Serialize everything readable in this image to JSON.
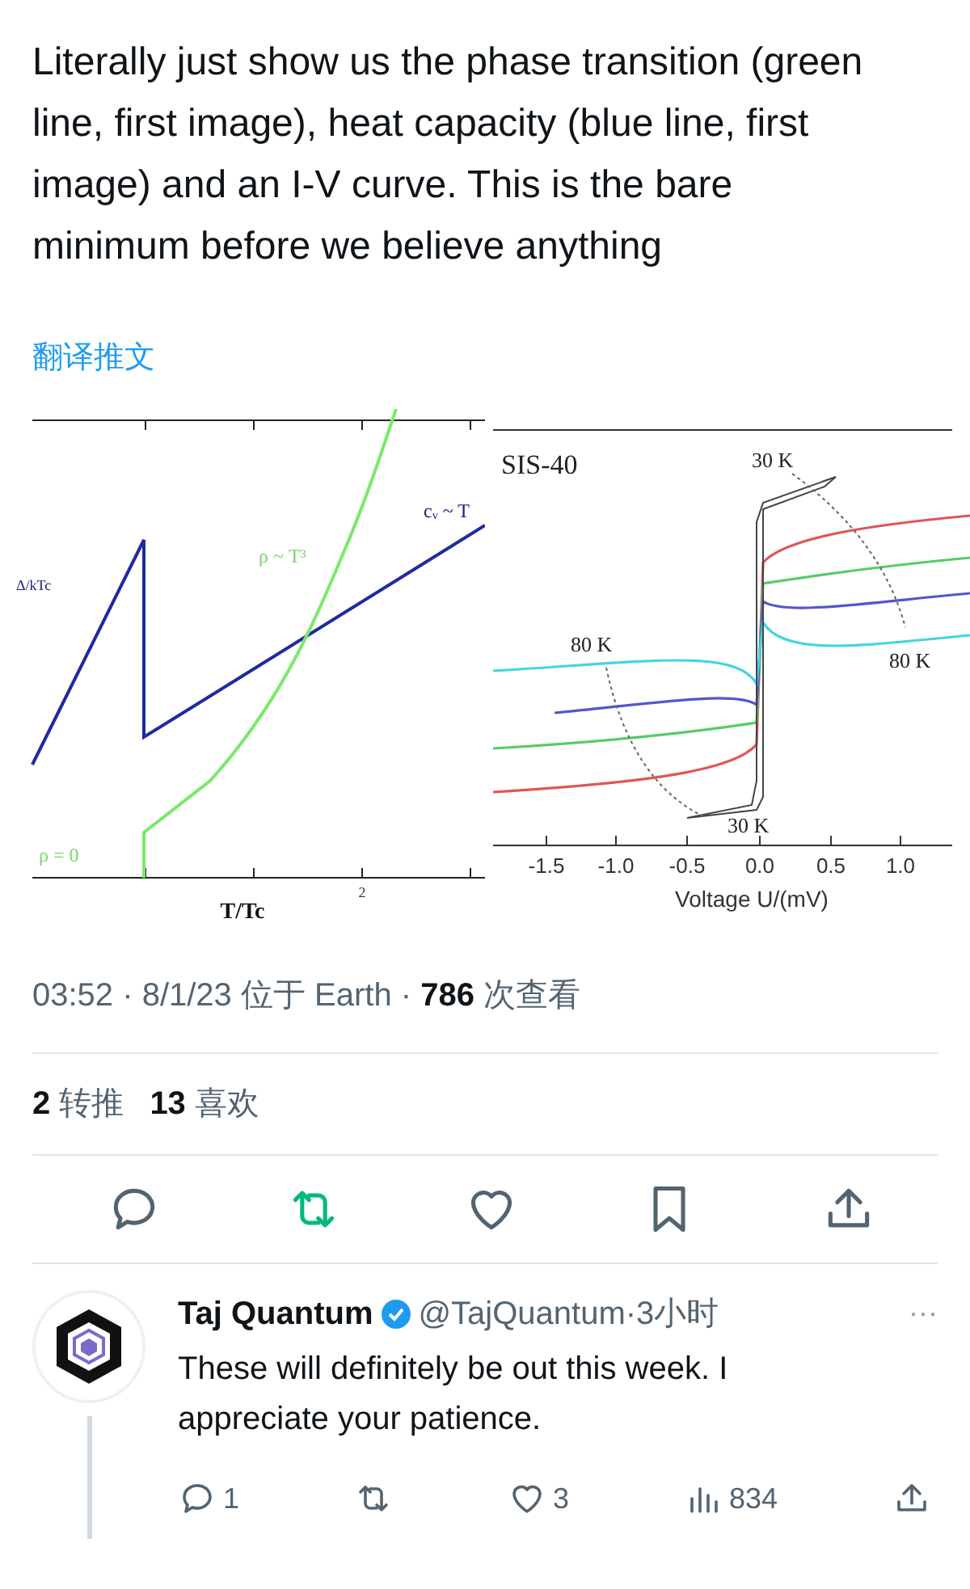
{
  "tweet": {
    "text": "Literally just show us the phase transition (green line, first image), heat capacity (blue line, first image) and an I-V curve. This is the bare minimum before we believe anything",
    "translate_link": "翻译推文",
    "media": [
      {
        "kind": "heat",
        "labels": [
          "Δ/kTc",
          "ρ ~ T³",
          "cᵥ ~ T",
          "ρ = 0",
          "2",
          "T/Tc"
        ]
      },
      {
        "kind": "iv",
        "labels": [
          "SIS-40",
          "30 K",
          "80 K",
          "80 K",
          "30 K",
          "-1.5",
          "-1.0",
          "-0.5",
          "0.0",
          "0.5",
          "1.0",
          "Voltage U/(mV)"
        ]
      }
    ],
    "meta": "03:52 · 8/1/23 位于 Earth · **786** 次查看",
    "stats": [
      {
        "count": "2",
        "label": "转推"
      },
      {
        "count": "13",
        "label": "喜欢"
      }
    ],
    "actions": {
      "retweeted": true
    }
  },
  "reply": {
    "name": "Taj Quantum",
    "verified": true,
    "handle": "@TajQuantum·3小时",
    "text": "These will definitely be out this week. I appreciate your patience.",
    "more": "···",
    "counts": {
      "replies": "1",
      "likes": "3",
      "views": "834"
    }
  }
}
